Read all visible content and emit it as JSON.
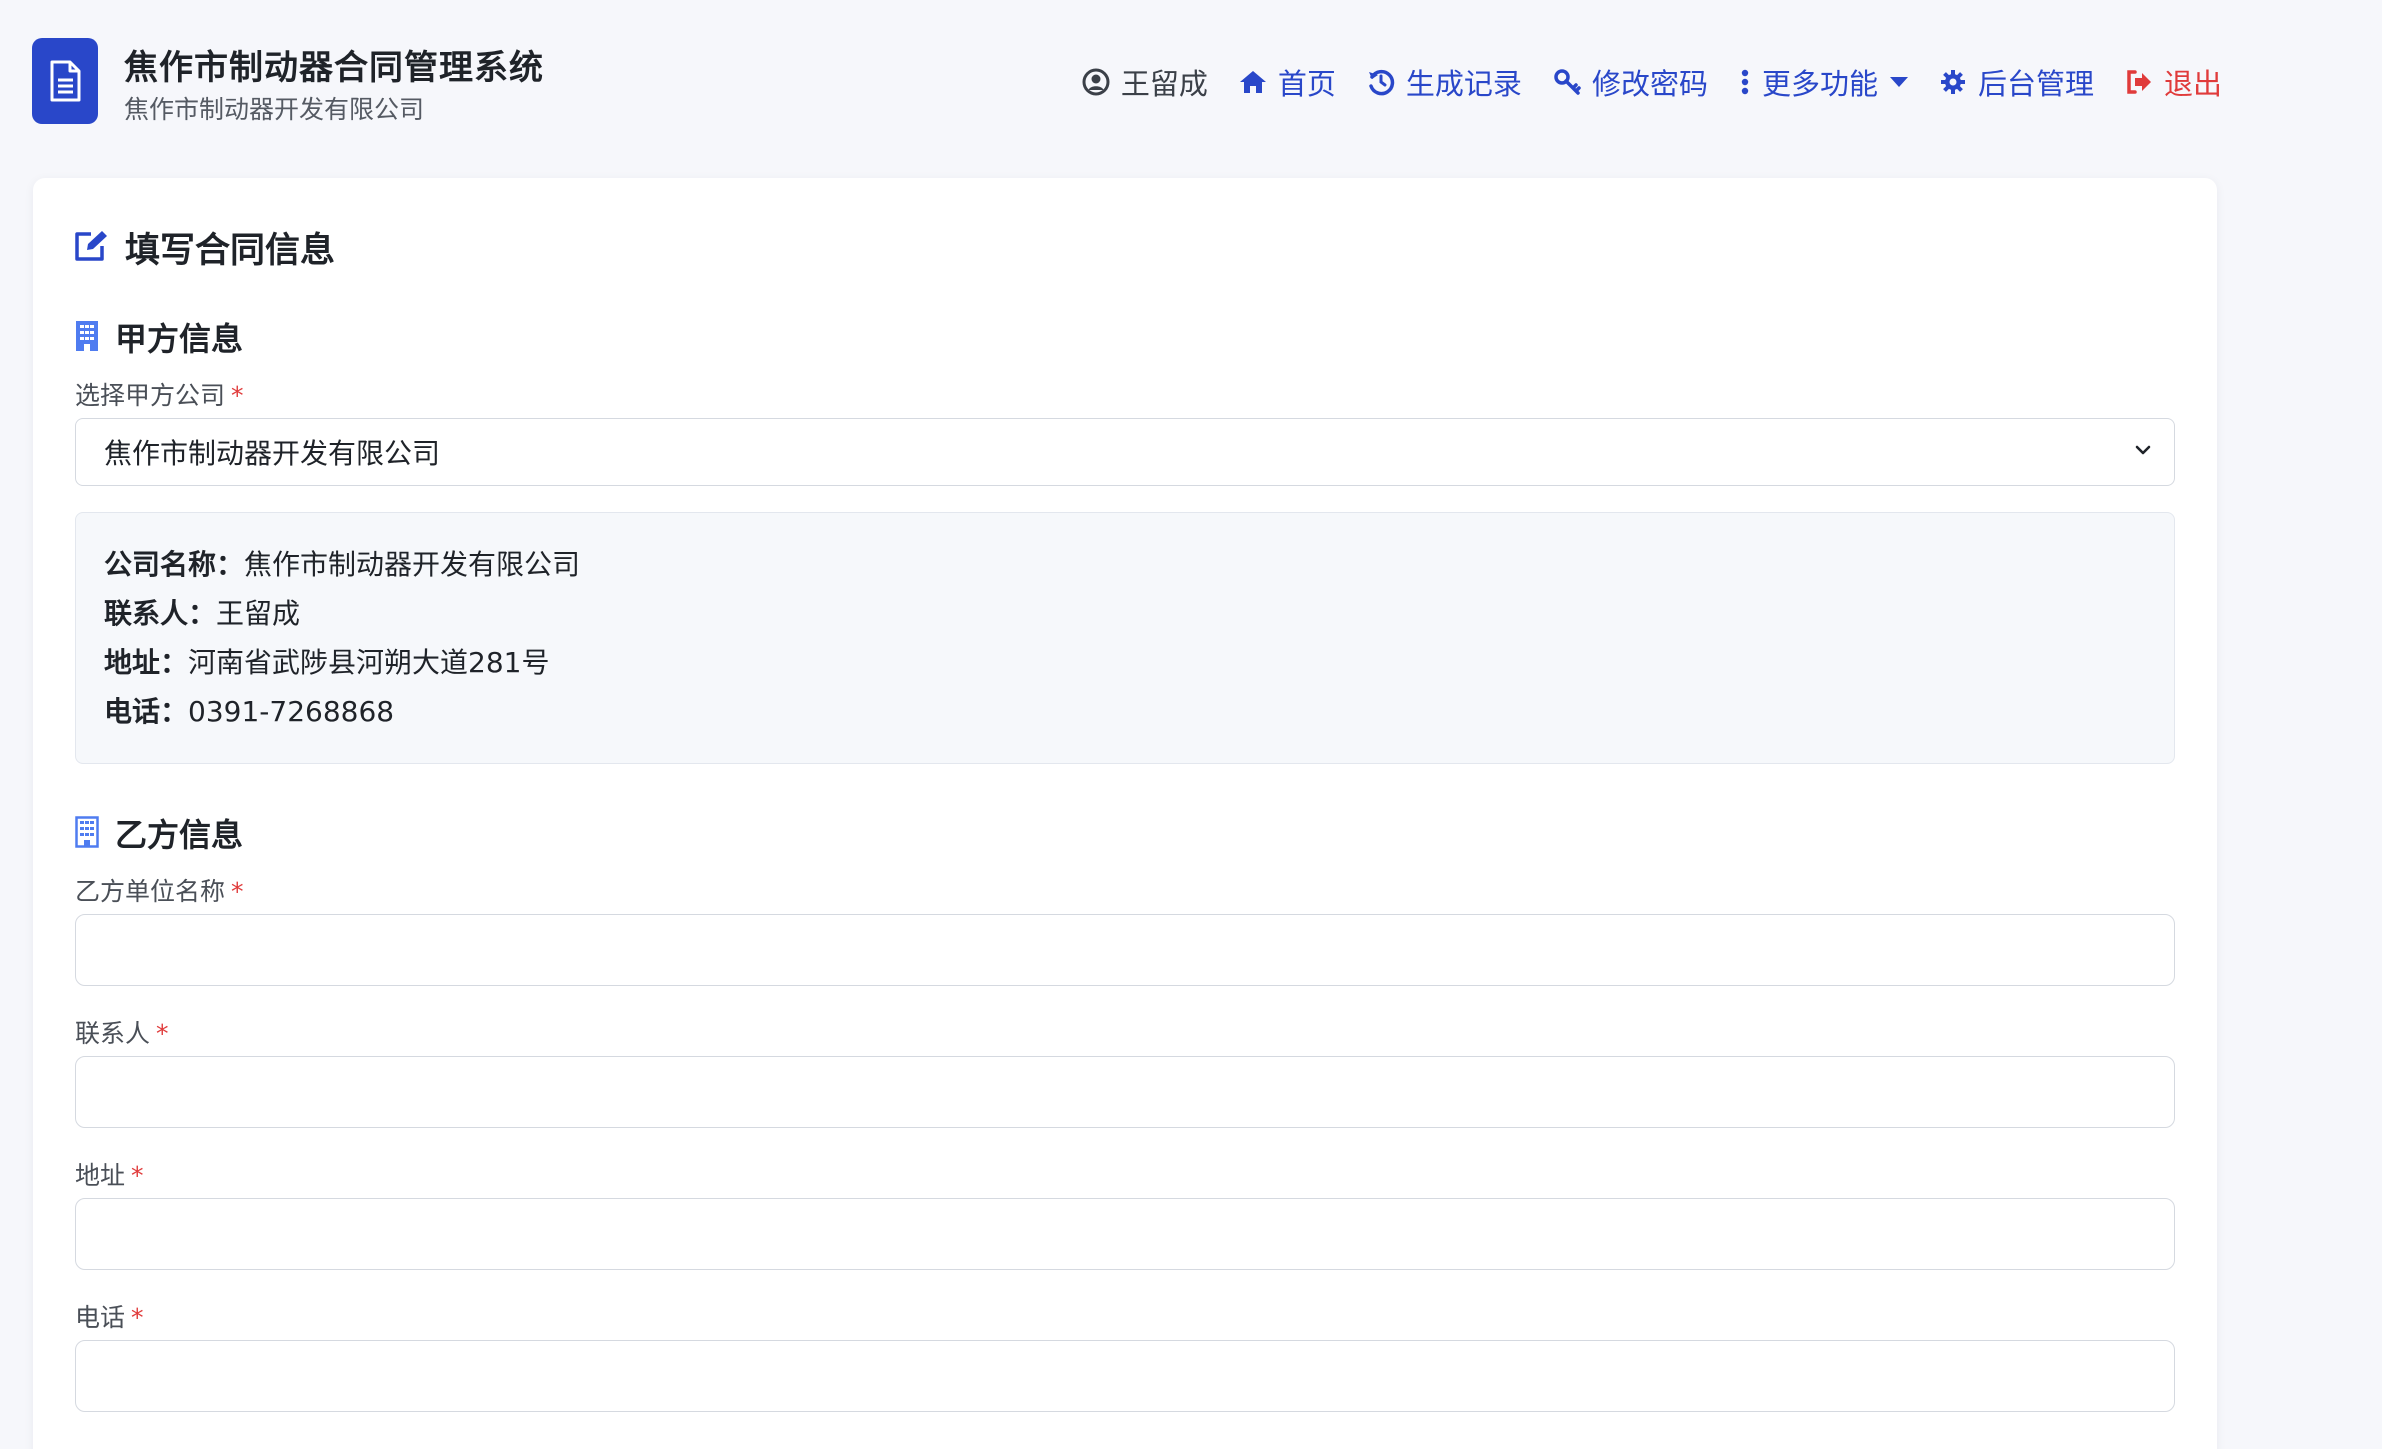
{
  "app": {
    "title": "焦作市制动器合同管理系统",
    "subtitle": "焦作市制动器开发有限公司"
  },
  "nav": {
    "user": "王留成",
    "home": "首页",
    "records": "生成记录",
    "change_password": "修改密码",
    "more": "更多功能",
    "admin": "后台管理",
    "logout": "退出"
  },
  "form": {
    "title": "填写合同信息",
    "party_a": {
      "section_title": "甲方信息",
      "select_label": "选择甲方公司",
      "required_mark": "*",
      "selected_company": "焦作市制动器开发有限公司",
      "details": {
        "company_label": "公司名称：",
        "company_value": "焦作市制动器开发有限公司",
        "contact_label": "联系人：",
        "contact_value": "王留成",
        "address_label": "地址：",
        "address_value": "河南省武陟县河朔大道281号",
        "phone_label": "电话：",
        "phone_value": "0391-7268868"
      }
    },
    "party_b": {
      "section_title": "乙方信息",
      "required_mark": "*",
      "company_label": "乙方单位名称",
      "company_value": "",
      "contact_label": "联系人",
      "contact_value": "",
      "address_label": "地址",
      "address_value": "",
      "phone_label": "电话",
      "phone_value": ""
    }
  },
  "colors": {
    "brand": "#2947c9",
    "danger": "#e03b3b",
    "background": "#f6f7fb"
  },
  "icons": {
    "logo": "document-icon",
    "user": "user-circle-icon",
    "home": "home-icon",
    "records": "history-icon",
    "password": "key-icon",
    "more": "vertical-ellipsis-icon",
    "admin": "gear-icon",
    "logout": "sign-out-icon",
    "form": "edit-icon",
    "building": "building-icon"
  }
}
